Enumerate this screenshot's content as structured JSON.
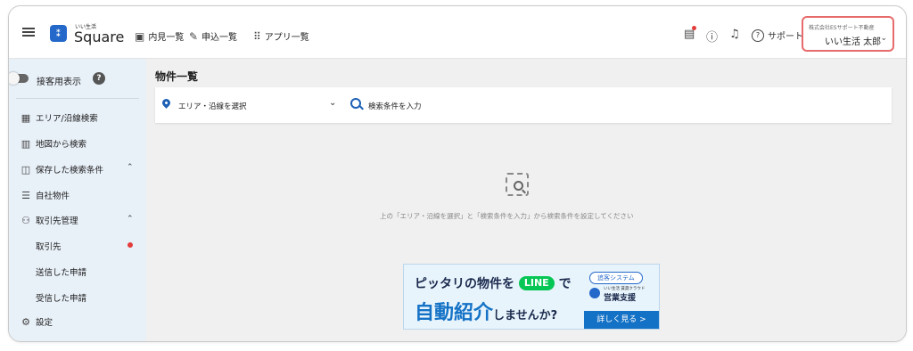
{
  "header": {
    "logo_small": "いい生活",
    "logo_text": "Square",
    "nav": [
      {
        "icon": "calendar-icon",
        "label": "内見一覧"
      },
      {
        "icon": "pen-icon",
        "label": "申込一覧"
      },
      {
        "icon": "apps-grid-icon",
        "label": "アプリ一覧"
      }
    ],
    "support_label": "サポート",
    "user": {
      "company": "株式会社ESサポート不動産",
      "name": "いい生活 太郎"
    }
  },
  "sidebar": {
    "customer_toggle_label": "接客用表示",
    "items": [
      {
        "icon": "building-icon",
        "label": "エリア/沿線検索"
      },
      {
        "icon": "map-icon",
        "label": "地図から検索"
      },
      {
        "icon": "saved-search-icon",
        "label": "保存した検索条件"
      },
      {
        "icon": "list-icon",
        "label": "自社物件"
      },
      {
        "icon": "people-icon",
        "label": "取引先管理"
      },
      {
        "icon": "settings-icon",
        "label": "設定"
      }
    ],
    "subitems": [
      "取引先",
      "送信した申請",
      "受信した申請"
    ]
  },
  "main": {
    "title": "物件一覧",
    "area_select_label": "エリア・沿線を選択",
    "keyword_placeholder": "検索条件を入力",
    "empty_message": "上の「エリア・沿線を選択」と「検索条件を入力」から検索条件を設定してください",
    "banner": {
      "line1_pre": "ピッタリの物件を",
      "line_pill": "LINE",
      "line1_post": "で",
      "line2_big": "自動紹介",
      "line2_small": "しませんか?",
      "tag": "追客システム",
      "service_small": "いい生活 賃貸クラウド",
      "service": "営業支援",
      "cta": "詳しく見る >"
    }
  },
  "colors": {
    "brand_blue": "#2468c9",
    "sidebar_bg": "#e8f0f8",
    "main_bg": "#f0f0f0",
    "user_highlight": "#e86b6b",
    "line_green": "#06c755",
    "alert_dot": "#e43b3b"
  }
}
